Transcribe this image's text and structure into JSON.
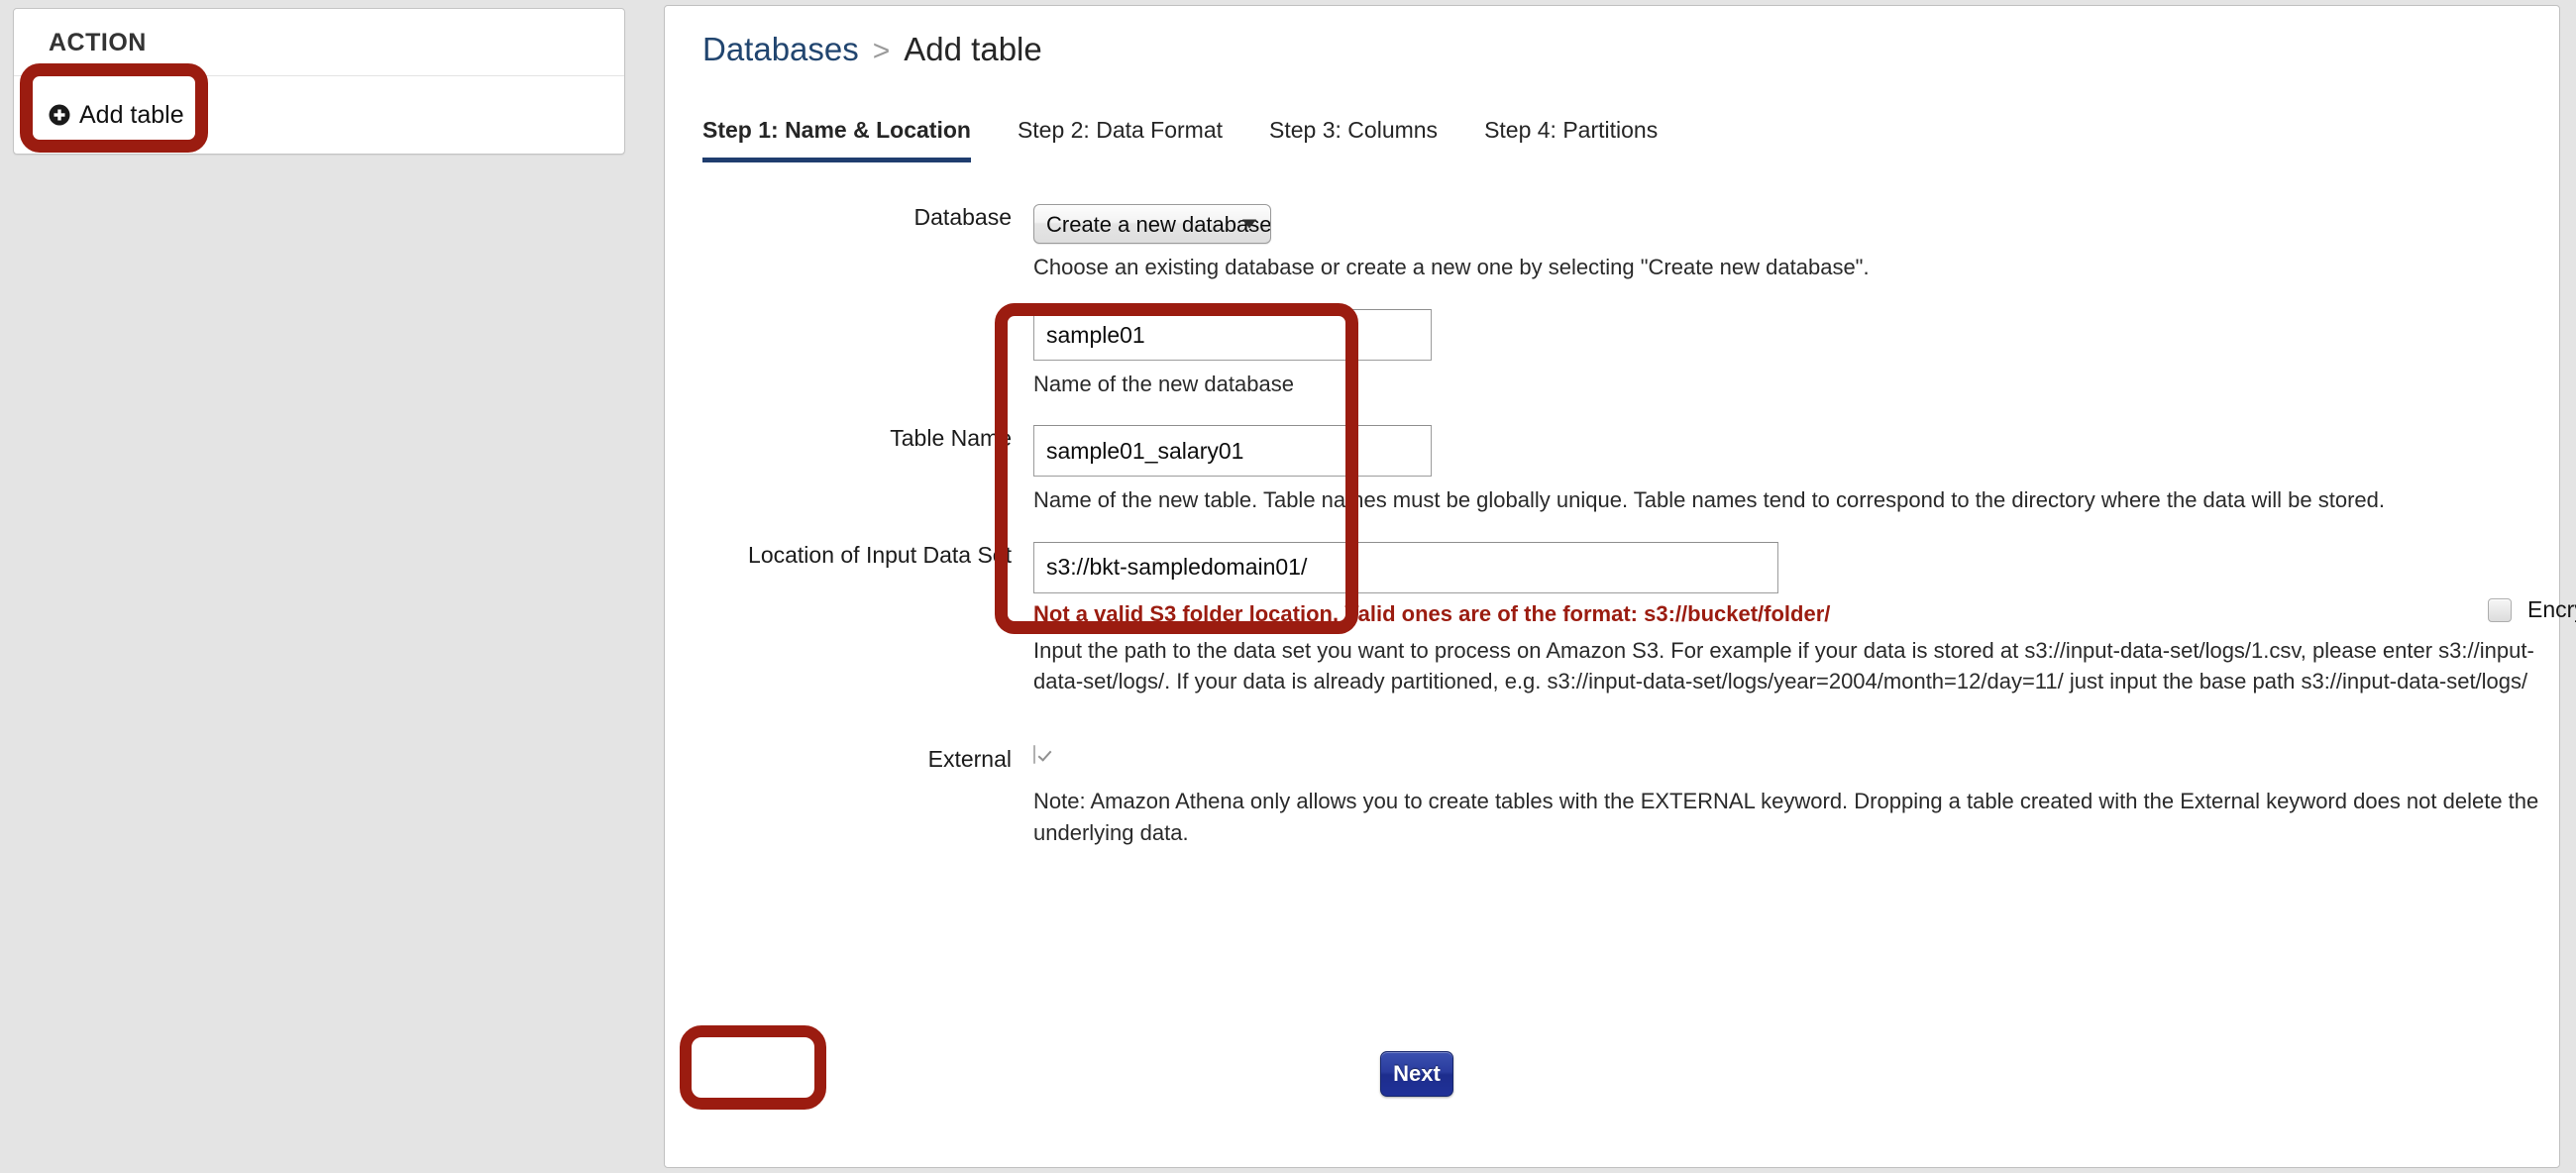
{
  "sidebar": {
    "header": "ACTION",
    "add_table_label": "Add table"
  },
  "breadcrumb": {
    "parent": "Databases",
    "separator": ">",
    "current": "Add table"
  },
  "tabs": [
    {
      "label": "Step 1: Name & Location",
      "active": true
    },
    {
      "label": "Step 2: Data Format",
      "active": false
    },
    {
      "label": "Step 3: Columns",
      "active": false
    },
    {
      "label": "Step 4: Partitions",
      "active": false
    }
  ],
  "form": {
    "database": {
      "label": "Database",
      "selected_option": "Create a new database",
      "hint": "Choose an existing database or create a new one by selecting \"Create new database\"."
    },
    "new_database_name": {
      "value": "sample01",
      "hint": "Name of the new database"
    },
    "table_name": {
      "label": "Table Name",
      "value": "sample01_salary01",
      "hint": "Name of the new table. Table names must be globally unique. Table names tend to correspond to the directory where the data will be stored."
    },
    "location": {
      "label": "Location of Input Data Set",
      "value": "s3://bkt-sampledomain01/",
      "error": "Not a valid S3 folder location. Valid ones are of the format: s3://bucket/folder/",
      "hint": "Input the path to the data set you want to process on Amazon S3. For example if your data is stored at s3://input-data-set/logs/1.csv, please enter s3://input-data-set/logs/. If your data is already partitioned, e.g. s3://input-data-set/logs/year=2004/month=12/day=11/ just input the base path s3://input-data-set/logs/"
    },
    "encrypted": {
      "label": "Encrypted data set",
      "checked": false
    },
    "external": {
      "label": "External",
      "checked": true,
      "hint": "Note: Amazon Athena only allows you to create tables with the EXTERNAL keyword. Dropping a table created with the External keyword does not delete the underlying data."
    },
    "next_button": "Next"
  },
  "colors": {
    "annotation_red": "#9b1c10",
    "link_blue": "#21456f",
    "tab_underline": "#1f3d6e",
    "button_blue": "#203198",
    "info_icon": "#1f3d8f"
  }
}
